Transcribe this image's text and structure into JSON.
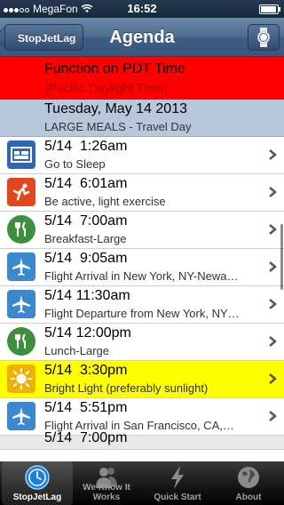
{
  "status_bar": {
    "carrier": "MegaFon",
    "time": "16:52"
  },
  "nav_bar": {
    "back_label": "StopJetLag",
    "title": "Agenda"
  },
  "banner_pdt": {
    "line1": "Function on PDT Time",
    "line2": "(Pacific Daylight Time)"
  },
  "day_header": {
    "date": "Tuesday, May 14 2013",
    "subtitle": "LARGE MEALS - Travel Day"
  },
  "agenda": [
    {
      "time": "5/14  1:26am",
      "activity": "Go to Sleep",
      "icon": "bed-icon",
      "color": "#2f66b3"
    },
    {
      "time": "5/14  6:01am",
      "activity": "Be active, light exercise",
      "icon": "exercise-icon",
      "color": "#e2461d"
    },
    {
      "time": "5/14  7:00am",
      "activity": "Breakfast-Large",
      "icon": "meal-icon",
      "color": "#3c8f3c"
    },
    {
      "time": "5/14  9:05am",
      "activity": "Flight Arrival in New York, NY-Newa…",
      "icon": "airplane-icon",
      "color": "#3c88cf"
    },
    {
      "time": "5/14 11:30am",
      "activity": "Flight Departure from New York, NY…",
      "icon": "airplane-icon",
      "color": "#3c88cf"
    },
    {
      "time": "5/14 12:00pm",
      "activity": "Lunch-Large",
      "icon": "meal-icon",
      "color": "#3c8f3c"
    },
    {
      "time": "5/14  3:30pm",
      "activity": "Bright Light (preferably sunlight)",
      "icon": "sun-icon",
      "color": "#f0b000",
      "highlight": "#ffff00"
    },
    {
      "time": "5/14  5:51pm",
      "activity": "Flight Arrival in San Francisco, CA,…",
      "icon": "airplane-icon",
      "color": "#3c88cf"
    },
    {
      "time": "5/14  7:00pm",
      "activity": "",
      "icon": "",
      "color": "#cccccc"
    }
  ],
  "tabs": [
    {
      "label": "StopJetLag",
      "icon": "clock-icon",
      "selected": true
    },
    {
      "label": "We Know It Works",
      "icon": "people-icon",
      "selected": false
    },
    {
      "label": "Quick Start",
      "icon": "lightning-icon",
      "selected": false
    },
    {
      "label": "About",
      "icon": "globe-icon",
      "selected": false
    }
  ]
}
